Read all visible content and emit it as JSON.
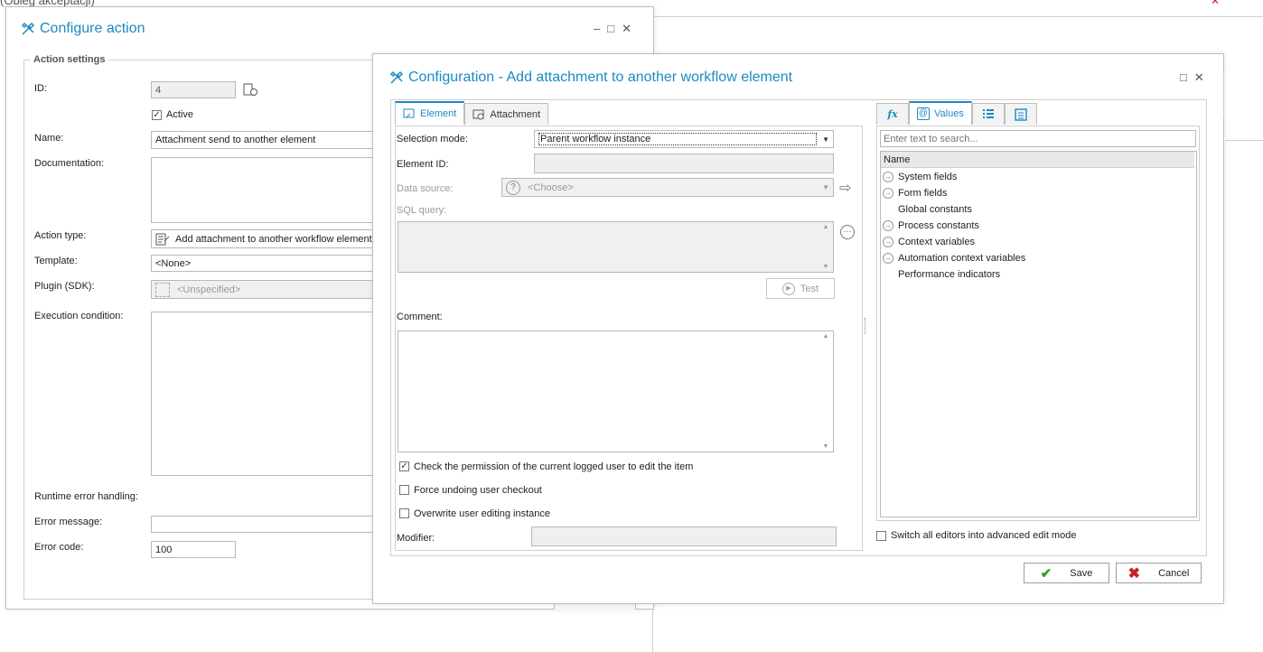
{
  "background": {
    "title_fragment": "...",
    "title_sub": "(Obieg akceptacji)"
  },
  "configure_action": {
    "title": "Configure action",
    "group_title": "Action settings",
    "id_label": "ID:",
    "id_value": "4",
    "active_label": "Active",
    "active_checked": true,
    "name_label": "Name:",
    "name_value": "Attachment send to another element",
    "documentation_label": "Documentation:",
    "action_type_label": "Action type:",
    "action_type_value": "Add attachment to another workflow element",
    "template_label": "Template:",
    "template_value": "<None>",
    "plugin_label": "Plugin (SDK):",
    "plugin_value": "<Unspecified>",
    "execution_condition_label": "Execution condition:",
    "runtime_error_label": "Runtime error handling:",
    "error_message_label": "Error message:",
    "error_message_value": "",
    "error_code_label": "Error code:",
    "error_code_value": "100"
  },
  "configuration": {
    "title": "Configuration - Add attachment to another workflow element",
    "tabs": [
      {
        "label": "Element",
        "active": true
      },
      {
        "label": "Attachment",
        "active": false
      }
    ],
    "selection_mode_label": "Selection mode:",
    "selection_mode_value": "Parent workflow instance",
    "element_id_label": "Element ID:",
    "data_source_label": "Data source:",
    "data_source_value": "<Choose>",
    "sql_query_label": "SQL query:",
    "test_label": "Test",
    "comment_label": "Comment:",
    "checkboxes": [
      {
        "label": "Check the permission of the current logged user to edit the item",
        "checked": true
      },
      {
        "label": "Force undoing user checkout",
        "checked": false
      },
      {
        "label": "Overwrite user editing instance",
        "checked": false
      }
    ],
    "modifier_label": "Modifier:",
    "right_tabs": [
      {
        "label": "fx",
        "icon": "function-icon",
        "active": false
      },
      {
        "label": "Values",
        "icon": "at-sign-icon",
        "active": true
      },
      {
        "label": "",
        "icon": "list-icon",
        "active": false
      },
      {
        "label": "",
        "icon": "form-icon",
        "active": false
      }
    ],
    "search_placeholder": "Enter text to search...",
    "tree_header": "Name",
    "tree_items": [
      {
        "label": "System fields",
        "expandable": true
      },
      {
        "label": "Form fields",
        "expandable": true
      },
      {
        "label": "Global constants",
        "expandable": false
      },
      {
        "label": "Process constants",
        "expandable": true
      },
      {
        "label": "Context variables",
        "expandable": true
      },
      {
        "label": "Automation context variables",
        "expandable": true
      },
      {
        "label": "Performance indicators",
        "expandable": false
      }
    ],
    "advanced_mode_label": "Switch all editors into advanced edit mode",
    "save_label": "Save",
    "cancel_label": "Cancel"
  },
  "colors": {
    "accent": "#1b8ac4",
    "save_check": "#3a9a2a",
    "cancel_x": "#c8202a"
  }
}
